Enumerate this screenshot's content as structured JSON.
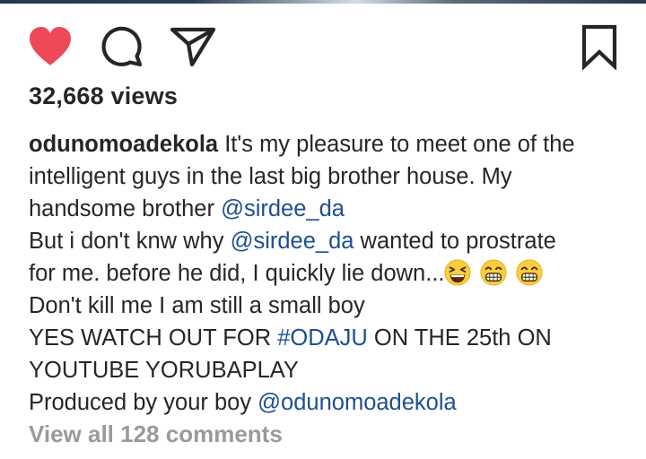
{
  "post": {
    "views": "32,668 views",
    "caption": {
      "username": "odunomoadekola",
      "line1_text": " It's my pleasure to meet one of the",
      "line2": "intelligent guys in the last big brother house. My",
      "line3_text": "handsome brother ",
      "mention1": "@sirdee_da",
      "line4_text1": "But i don't knw why ",
      "mention2": "@sirdee_da",
      "line4_text2": " wanted to prostrate",
      "line5_text": "for me. before he did, I quickly lie down...",
      "line6": "Don't kill me I am still a small boy",
      "line7_text1": "YES WATCH OUT FOR ",
      "hashtag": "#ODAJU",
      "line7_text2": " ON THE 25th ON",
      "line8": "YOUTUBE YORUBAPLAY",
      "line9_text": "Produced by your boy ",
      "mention3": "@odunomoadekola"
    },
    "emojis": [
      "grinning-squinting-face-emoji",
      "beaming-face-emoji",
      "beaming-face-emoji"
    ],
    "view_comments": "View all 128 comments"
  },
  "actions": {
    "icons": [
      "heart-icon",
      "comment-icon",
      "share-icon",
      "bookmark-icon"
    ],
    "like_color": "#ed4956",
    "liked": true
  },
  "colors": {
    "text": "#262626",
    "link": "#1d4f91",
    "muted": "#9a9a9a"
  }
}
